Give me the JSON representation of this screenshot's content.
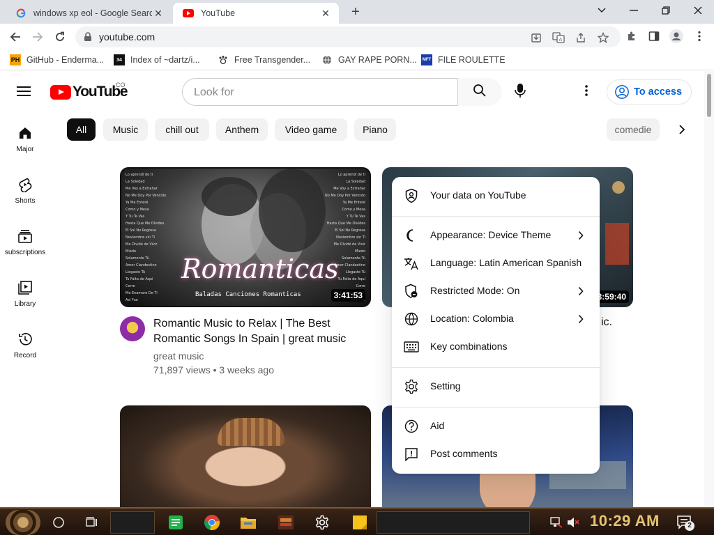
{
  "browser": {
    "tabs": [
      {
        "title": "windows xp eol - Google Search",
        "icon": "google-icon"
      },
      {
        "title": "YouTube",
        "icon": "youtube-icon"
      }
    ],
    "url": "youtube.com",
    "bookmarks": [
      {
        "label": "GitHub - Enderma...",
        "icon": "ph-icon"
      },
      {
        "label": "Index of ~dartz/i...",
        "icon": "index-icon"
      },
      {
        "label": "Free Transgender...",
        "icon": "paw-icon"
      },
      {
        "label": "GAY RAPE PORN...",
        "icon": "globe-icon"
      },
      {
        "label": "FILE ROULETTE",
        "icon": "mft-icon"
      }
    ]
  },
  "youtube": {
    "logo_text": "YouTube",
    "country_code": "CO",
    "search_placeholder": "Look for",
    "sign_in_label": "To access",
    "guide": [
      {
        "label": "Major",
        "icon": "home-icon"
      },
      {
        "label": "Shorts",
        "icon": "shorts-icon"
      },
      {
        "label": "subscriptions",
        "icon": "subscriptions-icon"
      },
      {
        "label": "Library",
        "icon": "library-icon"
      },
      {
        "label": "Record",
        "icon": "history-icon"
      }
    ],
    "chips": [
      "All",
      "Music",
      "chill out",
      "Anthem",
      "Video game",
      "Piano",
      "comedie"
    ],
    "videos": [
      {
        "title": "Romantic Music to Relax | The Best Romantic Songs In Spain | great music",
        "channel": "great music",
        "meta": "71,897 views • 3 weeks ago",
        "duration": "3:41:53",
        "thumb_text": "Romanticas",
        "thumb_subtext": "Baladas Canciones Romanticas"
      },
      {
        "title_fragment": "ic.",
        "duration": "3:59:40"
      }
    ]
  },
  "menu": {
    "items": [
      {
        "label": "Your data on YouTube",
        "icon": "shield-person-icon",
        "arrow": false
      },
      {
        "label": "Appearance: Device Theme",
        "icon": "moon-icon",
        "arrow": true
      },
      {
        "label": "Language: Latin American Spanish",
        "icon": "translate-icon",
        "arrow": true
      },
      {
        "label": "Restricted Mode: On",
        "icon": "restricted-icon",
        "arrow": true
      },
      {
        "label": "Location: Colombia",
        "icon": "globe-icon",
        "arrow": true
      },
      {
        "label": "Key combinations",
        "icon": "keyboard-icon",
        "arrow": false
      },
      {
        "label": "Setting",
        "icon": "gear-icon",
        "arrow": false
      },
      {
        "label": "Aid",
        "icon": "help-icon",
        "arrow": false
      },
      {
        "label": "Post comments",
        "icon": "feedback-icon",
        "arrow": false
      }
    ]
  },
  "taskbar": {
    "clock": "10:29 AM",
    "notification_count": "2"
  },
  "colors": {
    "youtube_red": "#ff0000",
    "link_blue": "#065fd4",
    "clock_gold": "#e8c372"
  }
}
